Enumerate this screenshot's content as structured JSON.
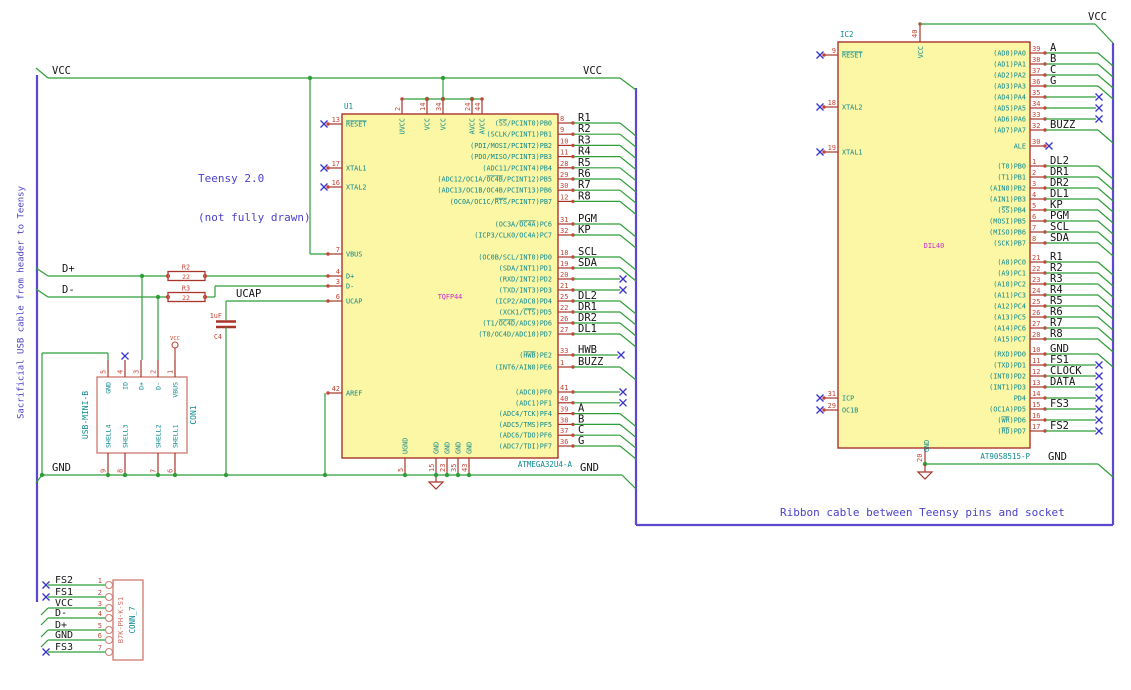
{
  "annotations": {
    "left_cable_note": "Sacrificial USB cable from header to Teensy",
    "teensy_note_line1": "Teensy 2.0",
    "teensy_note_line2": "(not fully drawn)",
    "ribbon_note": "Ribbon cable between Teensy pins and socket"
  },
  "power": {
    "vcc_left": "VCC",
    "vcc_u1_right": "VCC",
    "gnd_left": "GND",
    "gnd_u1_right": "GND",
    "vcc_ic2": "VCC",
    "gnd_ic2": "GND",
    "con1_vcc_port": "VCC"
  },
  "wire_labels": {
    "dplus": "D+",
    "dminus": "D-",
    "ucap": "UCAP"
  },
  "u1": {
    "ref": "U1",
    "value": "ATMEGA32U4-A",
    "footprint": "TQFP44",
    "left_pins": [
      {
        "num": "13",
        "name": "~RESET~",
        "term": "nc"
      },
      {
        "num": "17",
        "name": "XTAL1",
        "term": "nc"
      },
      {
        "num": "16",
        "name": "XTAL2",
        "term": "nc"
      },
      {
        "num": "7",
        "name": "VBUS",
        "term": "wire"
      },
      {
        "num": "4",
        "name": "D+",
        "term": "wire"
      },
      {
        "num": "3",
        "name": "D-",
        "term": "wire"
      },
      {
        "num": "6",
        "name": "UCAP",
        "term": "wire"
      },
      {
        "num": "42",
        "name": "AREF",
        "term": "wire"
      }
    ],
    "top_pins": [
      {
        "num": "2",
        "name": "UVCC"
      },
      {
        "num": "14",
        "name": "VCC"
      },
      {
        "num": "34",
        "name": "VCC"
      },
      {
        "num": "24",
        "name": "AVCC"
      },
      {
        "num": "44",
        "name": "AVCC"
      }
    ],
    "bottom_pins": [
      {
        "num": "5",
        "name": "UGND"
      },
      {
        "num": "15",
        "name": "GND"
      },
      {
        "num": "23",
        "name": "GND"
      },
      {
        "num": "35",
        "name": "GND"
      },
      {
        "num": "43",
        "name": "GND"
      }
    ],
    "right_groups": [
      {
        "rows": [
          {
            "num": "8",
            "name": "(~SS~/PCINT0)PB0",
            "label": "R1",
            "term": "bus"
          },
          {
            "num": "9",
            "name": "(SCLK/PCINT1)PB1",
            "label": "R2",
            "term": "bus"
          },
          {
            "num": "10",
            "name": "(PDI/MOSI/PCINT2)PB2",
            "label": "R3",
            "term": "bus"
          },
          {
            "num": "11",
            "name": "(PDO/MISO/PCINT3)PB3",
            "label": "R4",
            "term": "bus"
          },
          {
            "num": "28",
            "name": "(ADC11/PCINT4)PB4",
            "label": "R5",
            "term": "bus"
          },
          {
            "num": "29",
            "name": "(ADC12/OC1A/~OC4B~/PCINT12)PB5",
            "label": "R6",
            "term": "bus"
          },
          {
            "num": "30",
            "name": "(ADC13/OC1B/OC4B/PCINT13)PB6",
            "label": "R7",
            "term": "bus"
          },
          {
            "num": "12",
            "name": "(OC0A/OC1C/~RTS~/PCINT7)PB7",
            "label": "R8",
            "term": "bus"
          }
        ]
      },
      {
        "rows": [
          {
            "num": "31",
            "name": "(OC3A/~OC4A~)PC6",
            "label": "PGM",
            "term": "bus"
          },
          {
            "num": "32",
            "name": "(ICP3/CLK0/OC4A)PC7",
            "label": "KP",
            "term": "bus"
          }
        ]
      },
      {
        "rows": [
          {
            "num": "18",
            "name": "(OC0B/SCL/INT0)PD0",
            "label": "SCL",
            "term": "bus"
          },
          {
            "num": "19",
            "name": "(SDA/INT1)PD1",
            "label": "SDA",
            "term": "bus"
          },
          {
            "num": "20",
            "name": "(RXD/INT2)PD2",
            "label": "",
            "term": "nc"
          },
          {
            "num": "21",
            "name": "(TXD/INT3)PD3",
            "label": "",
            "term": "nc"
          },
          {
            "num": "25",
            "name": "(ICP2/ADC8)PD4",
            "label": "DL2",
            "term": "bus"
          },
          {
            "num": "22",
            "name": "(XCK1/~CTS~)PD5",
            "label": "DR1",
            "term": "bus"
          },
          {
            "num": "26",
            "name": "(T1/~OC4D~/ADC9)PD6",
            "label": "DR2",
            "term": "bus"
          },
          {
            "num": "27",
            "name": "(T0/OC4D/ADC10)PD7",
            "label": "DL1",
            "term": "bus"
          }
        ]
      },
      {
        "rows": [
          {
            "num": "33",
            "name": "(~HWB~)PE2",
            "label": "HWB",
            "term": "nc_label"
          },
          {
            "num": "1",
            "name": "(INT6/AIN0)PE6",
            "label": "BUZZ",
            "term": "bus"
          }
        ]
      },
      {
        "rows": [
          {
            "num": "41",
            "name": "(ADC0)PF0",
            "label": "",
            "term": "nc"
          },
          {
            "num": "40",
            "name": "(ADC1)PF1",
            "label": "",
            "term": "nc"
          },
          {
            "num": "39",
            "name": "(ADC4/TCK)PF4",
            "label": "A",
            "term": "bus"
          },
          {
            "num": "38",
            "name": "(ADC5/TMS)PF5",
            "label": "B",
            "term": "bus"
          },
          {
            "num": "37",
            "name": "(ADC6/TDO)PF6",
            "label": "C",
            "term": "bus"
          },
          {
            "num": "36",
            "name": "(ADC7/TDI)PF7",
            "label": "G",
            "term": "bus"
          }
        ]
      }
    ]
  },
  "ic2": {
    "ref": "IC2",
    "value": "AT90S8515-P",
    "footprint": "DIL40",
    "left_pins": [
      {
        "num": "9",
        "name": "~RESET~"
      },
      {
        "num": "18",
        "name": "XTAL2"
      },
      {
        "num": "19",
        "name": "XTAL1"
      },
      {
        "num": "31",
        "name": "ICP"
      },
      {
        "num": "29",
        "name": "OC1B"
      }
    ],
    "top_pins": [
      {
        "num": "40",
        "name": "VCC"
      }
    ],
    "bottom_pins": [
      {
        "num": "20",
        "name": "GND"
      }
    ],
    "right_groups": [
      {
        "rows": [
          {
            "num": "39",
            "name": "(AD0)PA0",
            "label": "A",
            "term": "bus"
          },
          {
            "num": "38",
            "name": "(AD1)PA1",
            "label": "B",
            "term": "bus"
          },
          {
            "num": "37",
            "name": "(AD2)PA2",
            "label": "C",
            "term": "bus"
          },
          {
            "num": "36",
            "name": "(AD3)PA3",
            "label": "G",
            "term": "bus"
          },
          {
            "num": "35",
            "name": "(AD4)PA4",
            "label": "",
            "term": "nc"
          },
          {
            "num": "34",
            "name": "(AD5)PA5",
            "label": "",
            "term": "nc"
          },
          {
            "num": "33",
            "name": "(AD6)PA6",
            "label": "",
            "term": "nc"
          },
          {
            "num": "32",
            "name": "(AD7)PA7",
            "label": "BUZZ",
            "term": "bus"
          }
        ]
      },
      {
        "rows": [
          {
            "num": "30",
            "name": "ALE",
            "label": "",
            "term": "nc_pin"
          }
        ]
      },
      {
        "rows": [
          {
            "num": "1",
            "name": "(T0)PB0",
            "label": "DL2",
            "term": "bus"
          },
          {
            "num": "2",
            "name": "(T1)PB1",
            "label": "DR1",
            "term": "bus"
          },
          {
            "num": "3",
            "name": "(AIN0)PB2",
            "label": "DR2",
            "term": "bus"
          },
          {
            "num": "4",
            "name": "(AIN1)PB3",
            "label": "DL1",
            "term": "bus"
          },
          {
            "num": "5",
            "name": "(~SS~)PB4",
            "label": "KP",
            "term": "bus"
          },
          {
            "num": "6",
            "name": "(MOSI)PB5",
            "label": "PGM",
            "term": "bus"
          },
          {
            "num": "7",
            "name": "(MISO)PB6",
            "label": "SCL",
            "term": "bus"
          },
          {
            "num": "8",
            "name": "(SCK)PB7",
            "label": "SDA",
            "term": "bus"
          }
        ]
      },
      {
        "rows": [
          {
            "num": "21",
            "name": "(A8)PC0",
            "label": "R1",
            "term": "bus"
          },
          {
            "num": "22",
            "name": "(A9)PC1",
            "label": "R2",
            "term": "bus"
          },
          {
            "num": "23",
            "name": "(A10)PC2",
            "label": "R3",
            "term": "bus"
          },
          {
            "num": "24",
            "name": "(A11)PC3",
            "label": "R4",
            "term": "bus"
          },
          {
            "num": "25",
            "name": "(A12)PC4",
            "label": "R5",
            "term": "bus"
          },
          {
            "num": "26",
            "name": "(A13)PC5",
            "label": "R6",
            "term": "bus"
          },
          {
            "num": "27",
            "name": "(A14)PC6",
            "label": "R7",
            "term": "bus"
          },
          {
            "num": "28",
            "name": "(A15)PC7",
            "label": "R8",
            "term": "bus"
          }
        ]
      },
      {
        "rows": [
          {
            "num": "10",
            "name": "(RXD)PD0",
            "label": "GND",
            "term": "bus"
          },
          {
            "num": "11",
            "name": "(TXD)PD1",
            "label": "FS1",
            "term": "nc_label"
          },
          {
            "num": "12",
            "name": "(INT0)PD2",
            "label": "CLOCK",
            "term": "nc_label"
          },
          {
            "num": "13",
            "name": "(INT1)PD3",
            "label": "DATA",
            "term": "nc_label"
          },
          {
            "num": "14",
            "name": "PD4",
            "label": "",
            "term": "nc"
          },
          {
            "num": "15",
            "name": "(OC1A)PD5",
            "label": "FS3",
            "term": "nc_label"
          },
          {
            "num": "16",
            "name": "(~WR~)PD6",
            "label": "",
            "term": "nc"
          },
          {
            "num": "17",
            "name": "(~RD~)PD7",
            "label": "FS2",
            "term": "nc_label"
          }
        ]
      }
    ]
  },
  "con1": {
    "ref": "CON1",
    "value": "USB-MINI-B",
    "top_pins": [
      {
        "num": "5",
        "name": "GND"
      },
      {
        "num": "4",
        "name": "ID"
      },
      {
        "num": "3",
        "name": "D+"
      },
      {
        "num": "2",
        "name": "D-"
      },
      {
        "num": "1",
        "name": "VBUS"
      }
    ],
    "bottom_pins": [
      {
        "num": "9",
        "name": "SHELL4"
      },
      {
        "num": "8",
        "name": "SHELL3"
      },
      {
        "num": "7",
        "name": "SHELL2"
      },
      {
        "num": "6",
        "name": "SHELL1"
      }
    ]
  },
  "conn7": {
    "ref": "CONN_7",
    "value": "B7K-PH-K-S1",
    "pins": [
      {
        "num": "1",
        "label": "FS2",
        "term": "nc"
      },
      {
        "num": "2",
        "label": "FS1",
        "term": "nc"
      },
      {
        "num": "3",
        "label": "VCC",
        "term": "stub"
      },
      {
        "num": "4",
        "label": "D-",
        "term": "stub"
      },
      {
        "num": "5",
        "label": "D+",
        "term": "stub"
      },
      {
        "num": "6",
        "label": "GND",
        "term": "stub"
      },
      {
        "num": "7",
        "label": "FS3",
        "term": "nc"
      }
    ]
  },
  "r2": {
    "ref": "R2",
    "value": "22"
  },
  "r3": {
    "ref": "R3",
    "value": "22"
  },
  "c4": {
    "ref": "C4",
    "value": "1uF"
  },
  "colors": {
    "wire": "#2f9e38",
    "bus": "#5a48cf",
    "note": "#4a42c8",
    "nc": "#3a35c8",
    "ic_fill": "#fcf7a5",
    "ic_outline": "#a8352a",
    "pin_number": "#c44536",
    "pin_name": "#0d8a8f",
    "label": "#161616",
    "footprint": "#cc29cc",
    "conn_outline": "#d08379",
    "conn_value": "#cc6a60"
  }
}
